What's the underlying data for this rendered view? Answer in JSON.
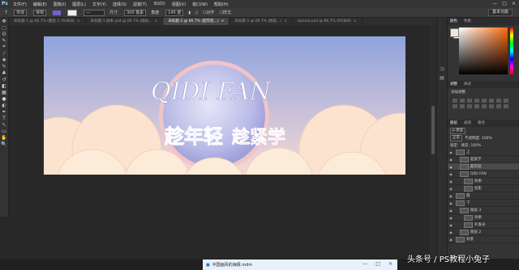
{
  "app": {
    "logo": "Ps"
  },
  "menu": [
    "文件(F)",
    "编辑(E)",
    "图像(I)",
    "图层(L)",
    "文字(Y)",
    "选择(S)",
    "滤镜(T)",
    "3D(D)",
    "视图(V)",
    "窗口(W)",
    "帮助(H)"
  ],
  "window_controls": [
    "—",
    "□",
    "×"
  ],
  "options": {
    "font_label": "宋体",
    "font_style": "常规",
    "antialias_label": "平滑",
    "size_label": "尺寸",
    "size_value": "300 像素",
    "angle_label": "角度",
    "angle_value": "145 度",
    "unit": "像素",
    "align_center": "居中",
    "checkbox1": "对齐",
    "checkbox2": "样式",
    "workspace": "基本功能"
  },
  "tabs": [
    {
      "label": "未标题-1 @ 66.7% (图层 2, RGB/8)",
      "active": false
    },
    {
      "label": "未标题-1 副本.psd @ 66.7% (图层...",
      "active": false
    },
    {
      "label": "未标题 2 @ 66.7% (超年轻...)",
      "active": true
    },
    {
      "label": "未标题-1 @ 66.7% (图层...)",
      "active": false
    },
    {
      "label": "banner.psd @ 66.7% (RGB/8)",
      "active": false
    }
  ],
  "tools": [
    "move-icon",
    "marquee-icon",
    "lasso-icon",
    "quick-select-icon",
    "crop-icon",
    "eyedropper-icon",
    "heal-icon",
    "brush-icon",
    "stamp-icon",
    "history-brush-icon",
    "eraser-icon",
    "gradient-icon",
    "blur-icon",
    "dodge-icon",
    "pen-icon",
    "type-icon",
    "path-select-icon",
    "shape-icon",
    "hand-icon",
    "zoom-icon"
  ],
  "tool_glyphs": [
    "✥",
    "⬚",
    "ʘ",
    "✎",
    "⌗",
    "⁄",
    "✚",
    "✎",
    "♣",
    "↺",
    "◧",
    "▦",
    "●",
    "◐",
    "✒",
    "T",
    "↖",
    "▭",
    "✋",
    "🔍"
  ],
  "color_panel": {
    "tab1": "颜色",
    "tab2": "色板"
  },
  "adjust_panel": {
    "tab1": "调整",
    "tab2": "样式",
    "title": "添加调整"
  },
  "layers_panel": {
    "tabs": [
      "图层",
      "通道",
      "路径"
    ],
    "filter_label": "ρ 类型",
    "blend_mode": "正常",
    "opacity_label": "不透明度: 100%",
    "lock_label": "锁定:",
    "fill_label": "填充: 100%",
    "layers": [
      {
        "name": "上",
        "indent": 0,
        "selected": false
      },
      {
        "name": "超紧学",
        "indent": 1,
        "selected": false
      },
      {
        "name": "超年轻",
        "indent": 1,
        "selected": true
      },
      {
        "name": "QIDI FAN",
        "indent": 1,
        "selected": false
      },
      {
        "name": "效果",
        "indent": 2,
        "selected": false
      },
      {
        "name": "投影",
        "indent": 2,
        "selected": false
      },
      {
        "name": "圆",
        "indent": 0,
        "selected": false
      },
      {
        "name": "下",
        "indent": 0,
        "selected": false
      },
      {
        "name": "图层 3",
        "indent": 1,
        "selected": false
      },
      {
        "name": "效果",
        "indent": 2,
        "selected": false
      },
      {
        "name": "外发光",
        "indent": 2,
        "selected": false
      },
      {
        "name": "图层 2",
        "indent": 1,
        "selected": false
      },
      {
        "name": "背景",
        "indent": 0,
        "selected": false
      }
    ]
  },
  "artwork": {
    "title_en": "QIDI FAN",
    "text_left": "趁年轻",
    "text_right": "趁紧学",
    "colors": {
      "sky_top": "#8ea3dd",
      "sky_bottom": "#f6d9d7",
      "sphere": "#b9bbe7",
      "ring": "#f0c4c8",
      "cloud": "#fbe3cf",
      "left_text": "#3b3d9a",
      "right_text": "#e8466a"
    }
  },
  "taskbar": {
    "window_title": "中国画风的海报.mdm"
  },
  "watermark": "头条号 / PS教程小兔子"
}
